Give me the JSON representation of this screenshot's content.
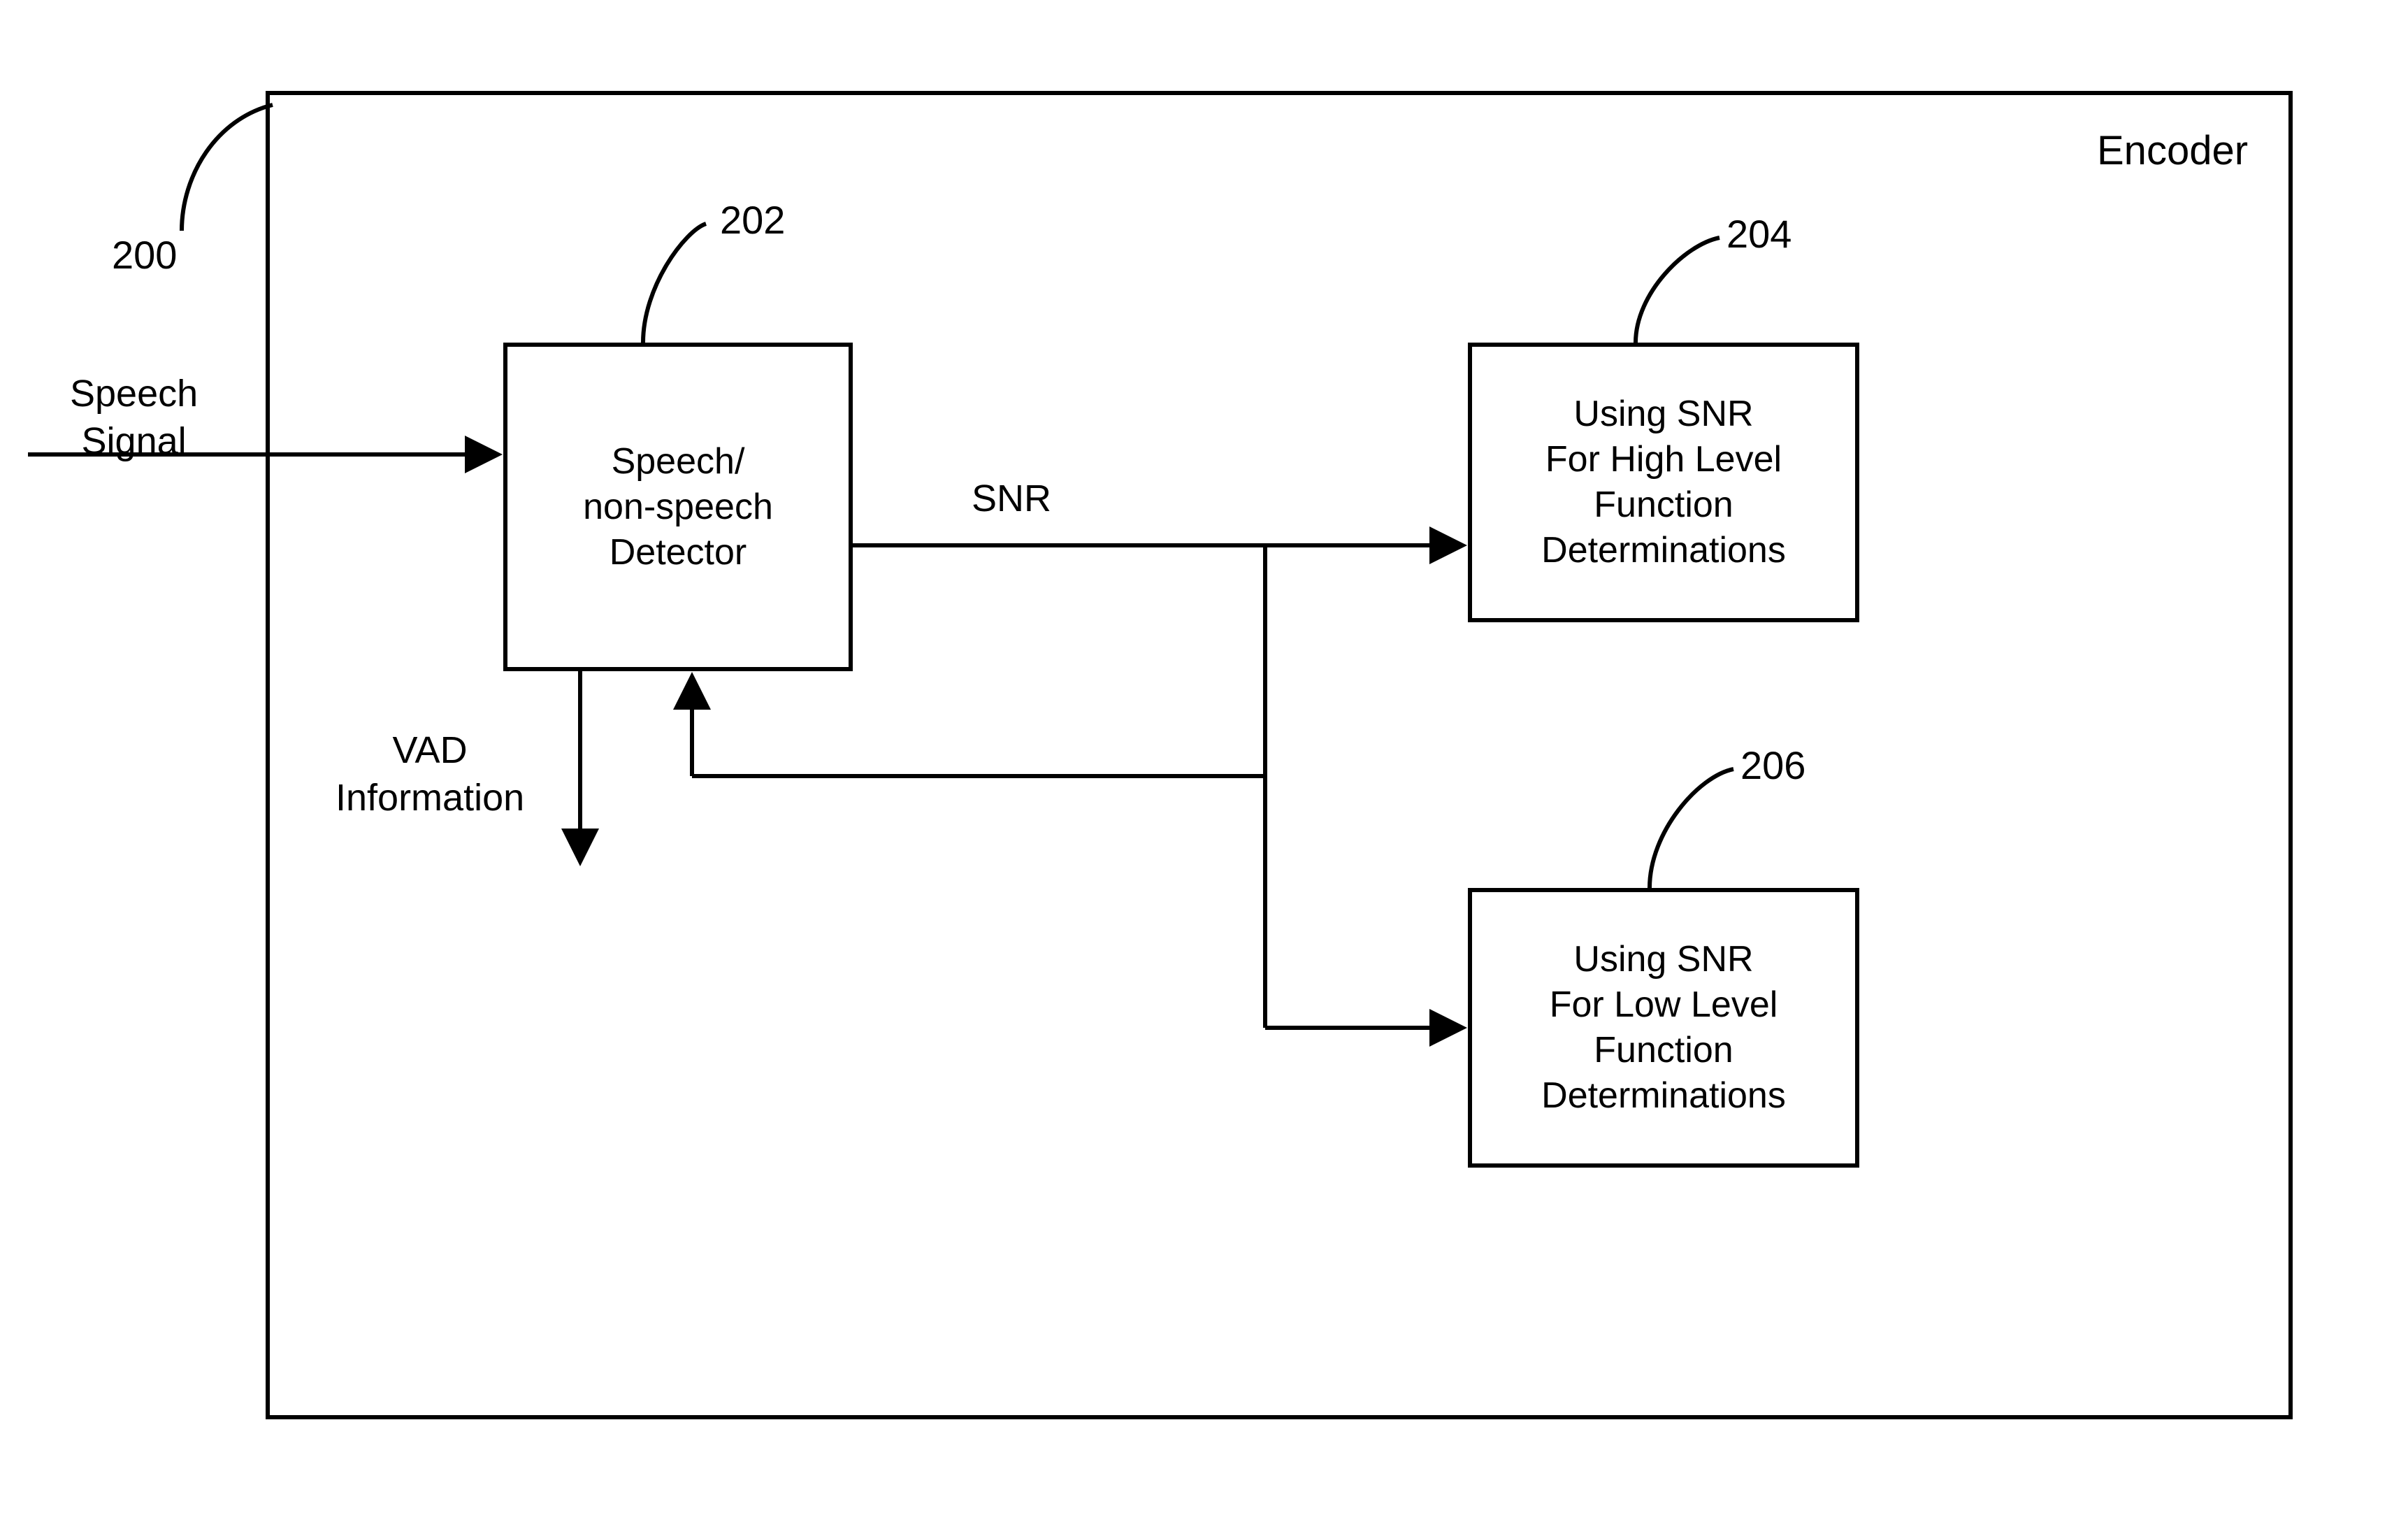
{
  "title": "Encoder",
  "refs": {
    "encoder": "200",
    "detector": "202",
    "high": "204",
    "low": "206"
  },
  "labels": {
    "input": "Speech\nSignal",
    "snr": "SNR",
    "vad": "VAD\nInformation"
  },
  "blocks": {
    "detector": "Speech/\nnon-speech\nDetector",
    "high": "Using SNR\nFor High Level\nFunction\nDeterminations",
    "low": "Using SNR\nFor Low Level\nFunction\nDeterminations"
  }
}
